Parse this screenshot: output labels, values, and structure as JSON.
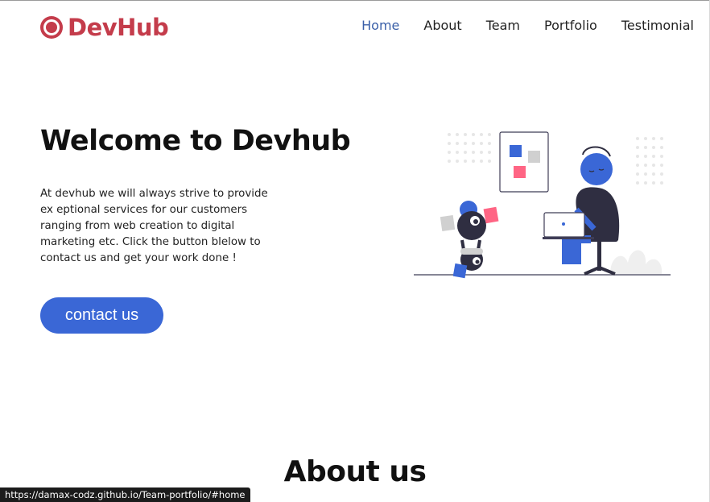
{
  "header": {
    "logo_text": "DevHub",
    "nav": [
      {
        "label": "Home",
        "active": true
      },
      {
        "label": "About"
      },
      {
        "label": "Team"
      },
      {
        "label": "Portfolio"
      },
      {
        "label": "Testimonial"
      }
    ]
  },
  "hero": {
    "title": "Welcome to Devhub",
    "text": "At devhub we will always strive to provide ex eptional services for our customers ranging from web creation to digital marketing etc. Click the button blelow to contact us and get your work done !",
    "cta_label": "contact us",
    "illustration": "person-working-laptop-illustration"
  },
  "about": {
    "title": "About us"
  },
  "status_bar": {
    "url": "https://damax-codz.github.io/Team-portfolio/#home"
  },
  "colors": {
    "brand": "#c43c4b",
    "accent": "#3a67d6",
    "nav_active": "#3a5fa8"
  }
}
